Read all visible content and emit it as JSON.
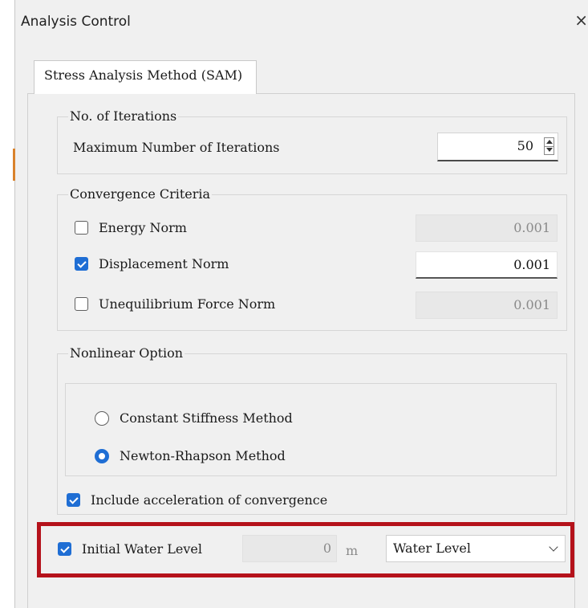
{
  "window": {
    "title": "Analysis Control",
    "close_icon": "×"
  },
  "tab": {
    "label": "Stress Analysis Method (SAM)"
  },
  "iterations": {
    "group_title": "No. of Iterations",
    "max_label": "Maximum Number of Iterations",
    "max_value": "50"
  },
  "convergence": {
    "group_title": "Convergence Criteria",
    "items": [
      {
        "label": "Energy Norm",
        "checked": false,
        "value": "0.001",
        "enabled": false
      },
      {
        "label": "Displacement Norm",
        "checked": true,
        "value": "0.001",
        "enabled": true
      },
      {
        "label": "Unequilibrium Force Norm",
        "checked": false,
        "value": "0.001",
        "enabled": false
      }
    ]
  },
  "nonlinear": {
    "group_title": "Nonlinear Option",
    "options": [
      {
        "label": "Constant Stiffness Method",
        "selected": false
      },
      {
        "label": "Newton-Rhapson Method",
        "selected": true
      }
    ],
    "acceleration_label": "Include acceleration of convergence",
    "acceleration_checked": true
  },
  "water": {
    "label": "Initial Water Level",
    "checked": true,
    "value": "0",
    "unit": "m",
    "dropdown_selected": "Water Level"
  },
  "colors": {
    "accent": "#1f6ed4",
    "highlight": "#b5121b"
  }
}
